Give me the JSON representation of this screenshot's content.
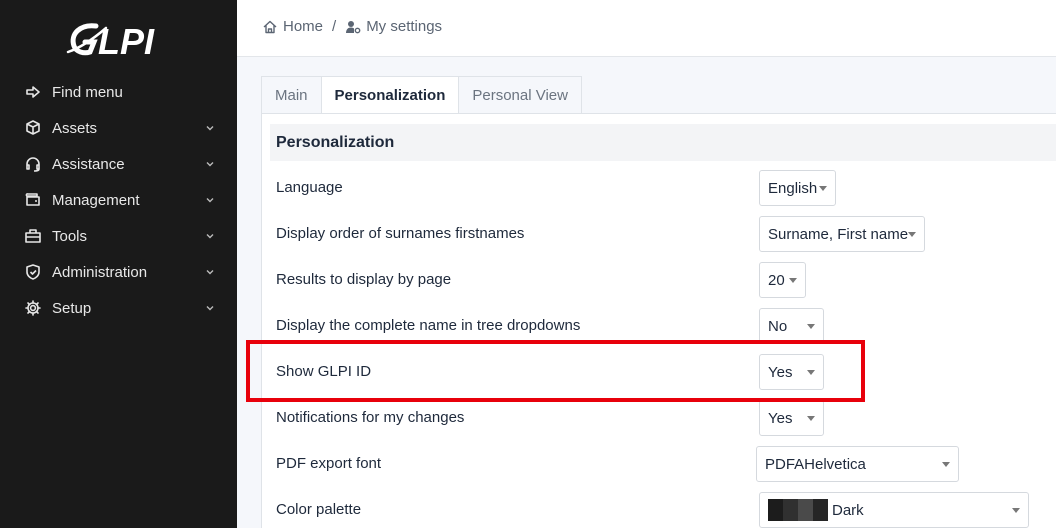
{
  "sidebar": {
    "logo_text": "GLPI",
    "items": [
      {
        "label": "Find menu",
        "icon": "arrow-right-icon",
        "has_chevron": false
      },
      {
        "label": "Assets",
        "icon": "box-icon",
        "has_chevron": true
      },
      {
        "label": "Assistance",
        "icon": "headset-icon",
        "has_chevron": true
      },
      {
        "label": "Management",
        "icon": "wallet-icon",
        "has_chevron": true
      },
      {
        "label": "Tools",
        "icon": "briefcase-icon",
        "has_chevron": true
      },
      {
        "label": "Administration",
        "icon": "shield-icon",
        "has_chevron": true
      },
      {
        "label": "Setup",
        "icon": "gear-icon",
        "has_chevron": true
      }
    ]
  },
  "breadcrumb": {
    "home": "Home",
    "separator": "/",
    "current": "My settings"
  },
  "tabs": [
    {
      "label": "Main",
      "active": false
    },
    {
      "label": "Personalization",
      "active": true
    },
    {
      "label": "Personal View",
      "active": false
    }
  ],
  "panel": {
    "title": "Personalization",
    "rows": [
      {
        "label": "Language",
        "value": "English"
      },
      {
        "label": "Display order of surnames firstnames",
        "value": "Surname, First name"
      },
      {
        "label": "Results to display by page",
        "value": "20"
      },
      {
        "label": "Display the complete name in tree dropdowns",
        "value": "No"
      },
      {
        "label": "Show GLPI ID",
        "value": "Yes"
      },
      {
        "label": "Notifications for my changes",
        "value": "Yes"
      },
      {
        "label": "PDF export font",
        "value": "PDFAHelvetica"
      },
      {
        "label": "Color palette",
        "value": "Dark"
      }
    ]
  },
  "colors": {
    "sidebar_bg": "#1a1a1a",
    "highlight": "#e8000b",
    "palette_swatches": [
      "#1c1c1c",
      "#303030",
      "#4a4a4a",
      "#262626"
    ]
  }
}
